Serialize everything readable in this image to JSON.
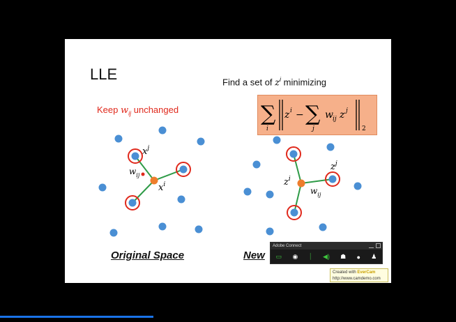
{
  "slide": {
    "title": "LLE",
    "find_prefix": "Find a set of ",
    "find_var": "z",
    "find_sup": "i",
    "find_suffix": " minimizing",
    "keep_prefix": "Keep ",
    "keep_var": "w",
    "keep_sub": "ij",
    "keep_suffix": " unchanged",
    "left_caption": "Original Space",
    "right_caption": "New",
    "left_labels": {
      "xj_base": "x",
      "xj_sup": "j",
      "xi_base": "x",
      "xi_sup": "i",
      "wij_base": "w",
      "wij_sub": "ij"
    },
    "right_labels": {
      "zj_base": "z",
      "zj_sup": "j",
      "zi_base": "z",
      "zi_sup": "i",
      "wij_base": "w",
      "wij_sub": "ij"
    },
    "formula": {
      "sum_index_outer": "i",
      "sum_index_inner": "j",
      "norm_sub": "2"
    }
  },
  "adobe_connect": {
    "title": "Adobe Connect",
    "icons": [
      "screen-share-icon",
      "webcam-icon",
      "microphone-icon",
      "speaker-icon",
      "attendees-icon",
      "chat-icon",
      "notification-icon"
    ]
  },
  "watermark": {
    "line1_prefix": "Created with ",
    "line1_brand": "EverCam",
    "line2": "http://www.camdemo.com"
  },
  "colors": {
    "dot": "#4a8fd4",
    "center": "#ee7d2c",
    "edge": "#2e9b47",
    "ring": "#e0291c",
    "formula_bg": "#f6b08a",
    "progress": "#1a73e8"
  }
}
